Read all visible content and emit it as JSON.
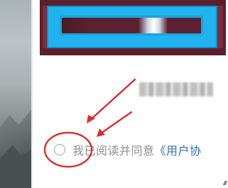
{
  "agreement": {
    "prefix": "我已阅读并同意",
    "link_label": "《用户协"
  },
  "colors": {
    "banner_outer": "#5b1f2c",
    "banner_inner": "#20b3ef",
    "link": "#2f6fb8",
    "annotation": "#d9302f"
  },
  "icons": {
    "radio": "radio-unchecked-icon"
  }
}
